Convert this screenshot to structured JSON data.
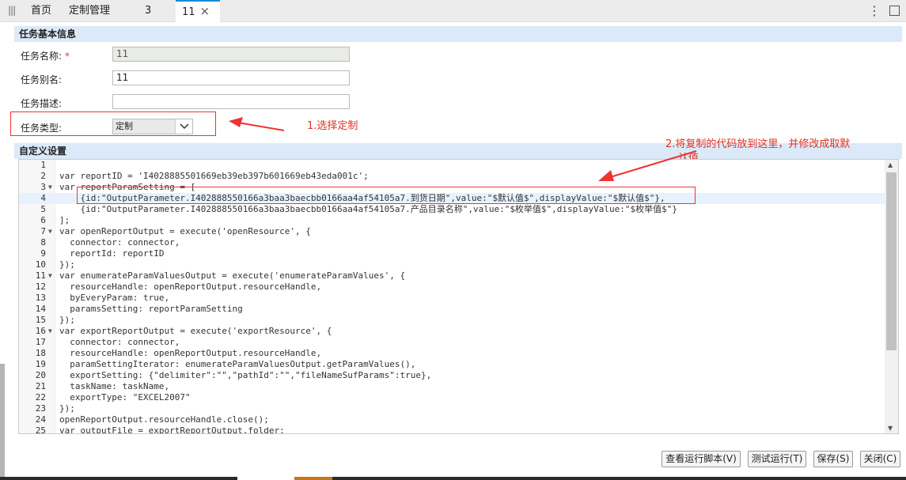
{
  "tabs": [
    {
      "label": "首页"
    },
    {
      "label": "定制管理"
    },
    {
      "label": "3"
    },
    {
      "label": "11",
      "close": "×"
    }
  ],
  "basic": {
    "header": "任务基本信息",
    "name_label": "任务名称:",
    "required_mark": "*",
    "name_value": "11",
    "alias_label": "任务别名:",
    "alias_value": "11",
    "desc_label": "任务描述:",
    "desc_value": "",
    "type_label": "任务类型:",
    "type_value": "定制"
  },
  "custom": {
    "header": "自定义设置"
  },
  "annotations": {
    "a1": "1.选择定制",
    "a2_line1": "2.将复制的代码放到这里，并修改成取默",
    "a2_line2": "认值"
  },
  "code": [
    {
      "n": "1",
      "t": ""
    },
    {
      "n": "2",
      "t": "var reportID = 'I4028885501669eb39eb397b601669eb43eda001c';"
    },
    {
      "n": "3",
      "t": "var reportParamSetting = [",
      "fold": true
    },
    {
      "n": "4",
      "t": "    {id:\"OutputParameter.I402888550166a3baa3baecbb0166aa4af54105a7.到货日期\",value:\"$默认值$\",displayValue:\"$默认值$\"},",
      "hl": true
    },
    {
      "n": "5",
      "t": "    {id:\"OutputParameter.I402888550166a3baa3baecbb0166aa4af54105a7.产品目录名称\",value:\"$枚举值$\",displayValue:\"$枚举值$\"}"
    },
    {
      "n": "6",
      "t": "];"
    },
    {
      "n": "7",
      "t": "var openReportOutput = execute('openResource', {",
      "fold": true
    },
    {
      "n": "8",
      "t": "  connector: connector,"
    },
    {
      "n": "9",
      "t": "  reportId: reportID"
    },
    {
      "n": "10",
      "t": "});"
    },
    {
      "n": "11",
      "t": "var enumerateParamValuesOutput = execute('enumerateParamValues', {",
      "fold": true
    },
    {
      "n": "12",
      "t": "  resourceHandle: openReportOutput.resourceHandle,"
    },
    {
      "n": "13",
      "t": "  byEveryParam: true,"
    },
    {
      "n": "14",
      "t": "  paramsSetting: reportParamSetting"
    },
    {
      "n": "15",
      "t": "});"
    },
    {
      "n": "16",
      "t": "var exportReportOutput = execute('exportResource', {",
      "fold": true
    },
    {
      "n": "17",
      "t": "  connector: connector,"
    },
    {
      "n": "18",
      "t": "  resourceHandle: openReportOutput.resourceHandle,"
    },
    {
      "n": "19",
      "t": "  paramSettingIterator: enumerateParamValuesOutput.getParamValues(),"
    },
    {
      "n": "20",
      "t": "  exportSetting: {\"delimiter\":\"\",\"pathId\":\"\",\"fileNameSufParams\":true},"
    },
    {
      "n": "21",
      "t": "  taskName: taskName,"
    },
    {
      "n": "22",
      "t": "  exportType: \"EXCEL2007\""
    },
    {
      "n": "23",
      "t": "});"
    },
    {
      "n": "24",
      "t": "openReportOutput.resourceHandle.close();"
    },
    {
      "n": "25",
      "t": "var outputFile = exportReportOutput.folder;"
    }
  ],
  "buttons": {
    "view_script": "查看运行脚本(V)",
    "test_run": "测试运行(T)",
    "save": "保存(S)",
    "close": "关闭(C)"
  },
  "colors": {
    "accent": "#1a88d8",
    "section_bg": "#dbe9f8",
    "annotation_red": "#d32f2f"
  }
}
